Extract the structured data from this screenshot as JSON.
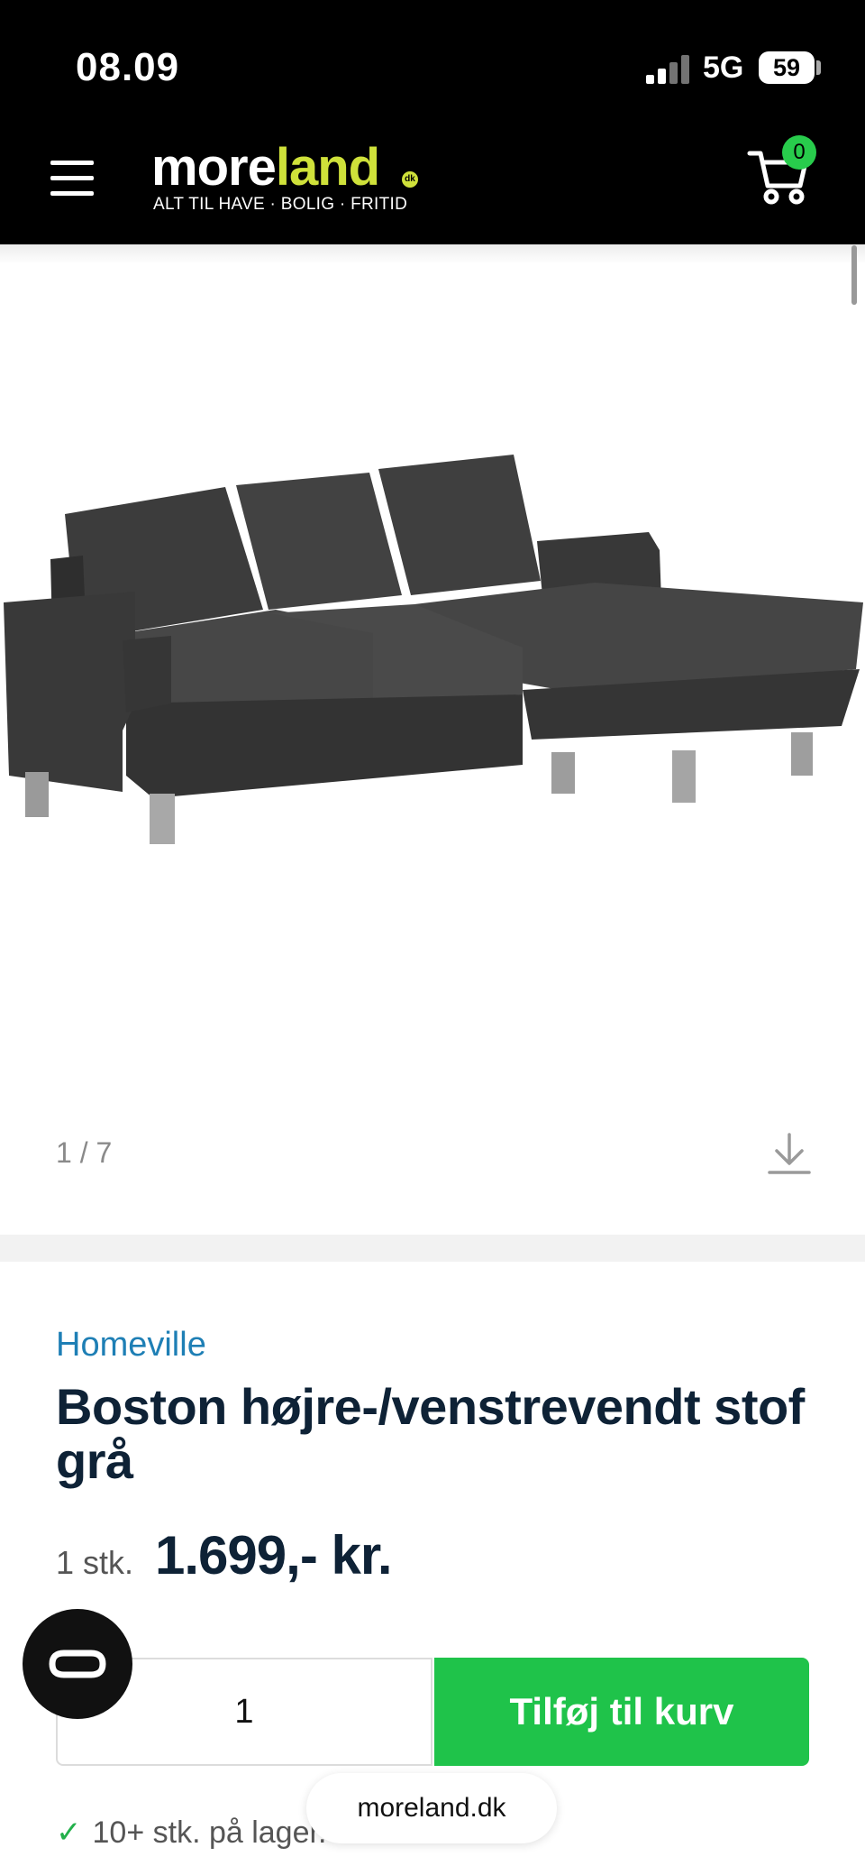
{
  "status_bar": {
    "time": "08.09",
    "network": "5G",
    "battery": "59"
  },
  "header": {
    "logo_part1": "more",
    "logo_part2": "land",
    "logo_dk": "dk",
    "logo_tagline": "ALT TIL HAVE · BOLIG · FRITID",
    "cart_count": "0"
  },
  "gallery": {
    "counter": "1 / 7"
  },
  "product": {
    "brand": "Homeville",
    "title": "Boston højre-/venstrevendt stof grå",
    "unit": "1 stk.",
    "price": "1.699,- kr.",
    "quantity": "1",
    "add_to_cart": "Tilføj til kurv",
    "stock": "10+ stk. på lager."
  },
  "browser": {
    "url": "moreland.dk"
  },
  "colors": {
    "accent_green": "#1fc34a",
    "brand_blue": "#1e7fb5",
    "logo_yellow": "#cfe13a",
    "dark_text": "#0e2236"
  }
}
